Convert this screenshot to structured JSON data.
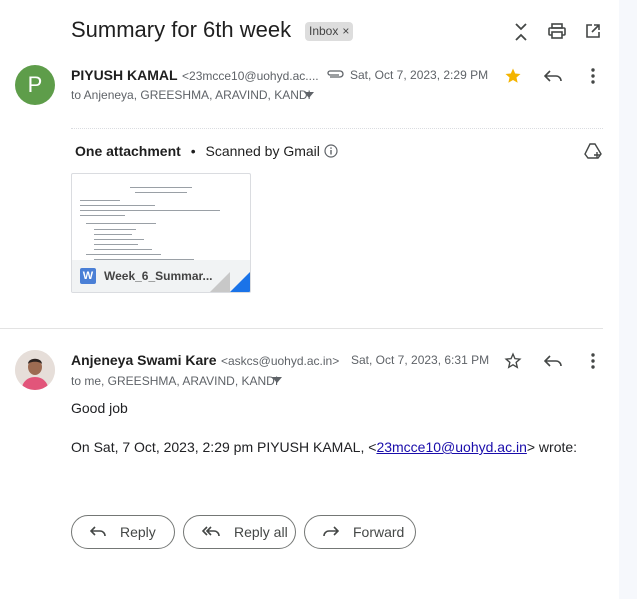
{
  "subject": "Summary for 6th week",
  "label_chip": {
    "text": "Inbox",
    "close": "×"
  },
  "message1": {
    "avatar_letter": "P",
    "avatar_color": "#5e9d4a",
    "sender_name": "PIYUSH KAMAL",
    "sender_email": "<23mcce10@uohyd.ac....",
    "date": "Sat, Oct 7, 2023, 2:29 PM",
    "to": "to Anjeneya, GREESHMA, ARAVIND, KANDI",
    "starred": true,
    "attachment_header": {
      "count": "One attachment",
      "separator": "•",
      "scanned": "Scanned by Gmail"
    },
    "attachment": {
      "type_letter": "W",
      "filename": "Week_6_Summar..."
    }
  },
  "message2": {
    "sender_name": "Anjeneya Swami Kare",
    "sender_email": "<askcs@uohyd.ac.in>",
    "date": "Sat, Oct 7, 2023, 6:31 PM",
    "to": "to me, GREESHMA, ARAVIND, KANDI",
    "starred": false,
    "body": "Good job",
    "quote_prefix": "On Sat, 7 Oct, 2023, 2:29 pm PIYUSH KAMAL, <",
    "quote_link": "23mcce10@uohyd.ac.in",
    "quote_suffix": "> wrote:"
  },
  "actions": {
    "reply": "Reply",
    "reply_all": "Reply all",
    "forward": "Forward"
  },
  "colors": {
    "star": "#f4b400",
    "link": "#1a0dab",
    "accent": "#1a73e8"
  }
}
